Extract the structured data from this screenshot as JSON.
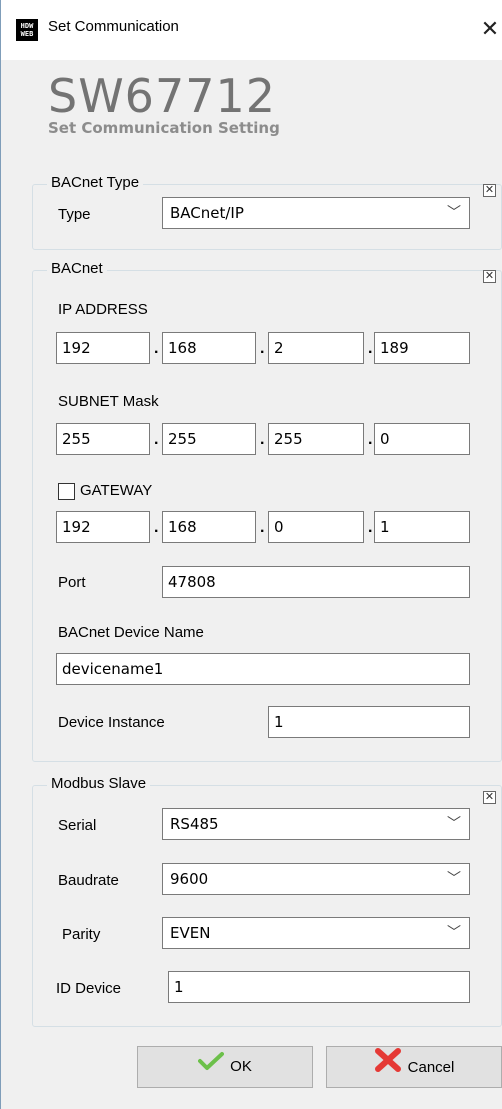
{
  "window": {
    "title": "Set Communication",
    "app_icon_text": "HDW\nWEB"
  },
  "brand": {
    "product": "SW67712",
    "subtitle": "Set Communication Setting"
  },
  "bacnet_type": {
    "legend": "BACnet Type",
    "type_label": "Type",
    "type_value": "BACnet/IP"
  },
  "bacnet": {
    "legend": "BACnet",
    "ip_label": "IP ADDRESS",
    "ip": [
      "192",
      "168",
      "2",
      "189"
    ],
    "subnet_label": "SUBNET Mask",
    "subnet": [
      "255",
      "255",
      "255",
      "0"
    ],
    "gateway_label": "GATEWAY",
    "gateway_checked": false,
    "gateway": [
      "192",
      "168",
      "0",
      "1"
    ],
    "port_label": "Port",
    "port": "47808",
    "device_name_label": "BACnet Device Name",
    "device_name": "devicename1",
    "instance_label": "Device Instance",
    "instance": "1"
  },
  "modbus": {
    "legend": "Modbus Slave",
    "serial_label": "Serial",
    "serial": "RS485",
    "baudrate_label": "Baudrate",
    "baudrate": "9600",
    "parity_label": "Parity",
    "parity": "EVEN",
    "id_label": "ID Device",
    "id": "1"
  },
  "buttons": {
    "ok": "OK",
    "cancel": "Cancel"
  },
  "colors": {
    "ok_check": "#6cc04a",
    "cancel_x": "#e53935"
  }
}
